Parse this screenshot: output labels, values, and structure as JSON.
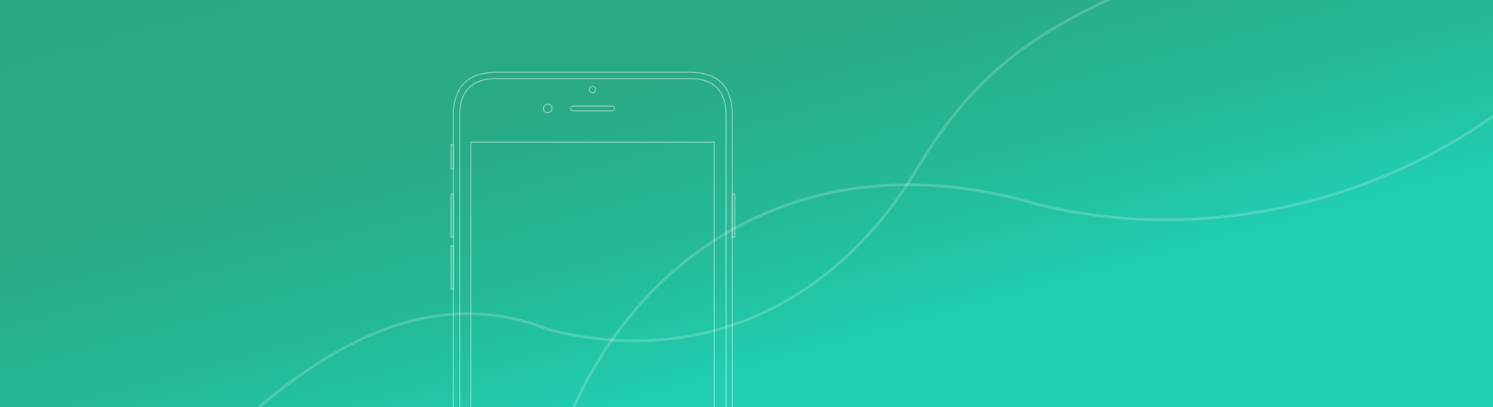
{
  "banner": {
    "background": {
      "gradient_start": "#2aa883",
      "gradient_mid": "#24b996",
      "gradient_end": "#20cfb2"
    },
    "line_color": "#ffffff",
    "illustration": "phone-outline"
  }
}
